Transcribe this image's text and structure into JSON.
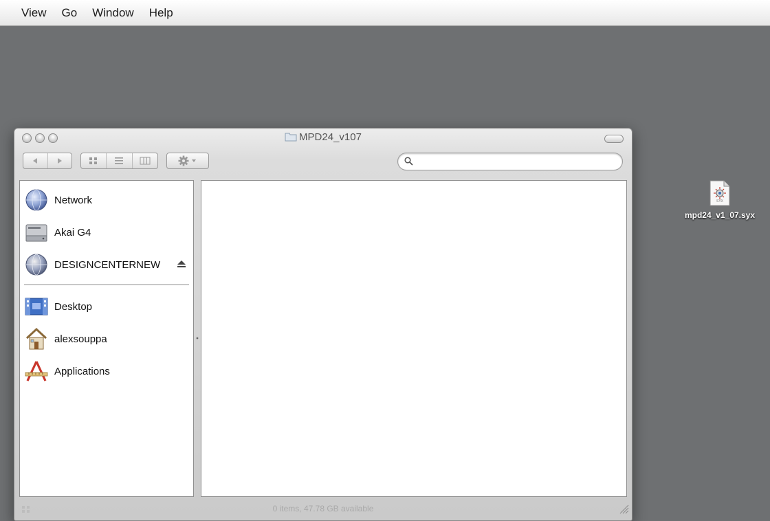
{
  "menubar": {
    "items": [
      "View",
      "Go",
      "Window",
      "Help"
    ]
  },
  "window": {
    "title": "MPD24_v107",
    "search": {
      "value": "",
      "placeholder": ""
    },
    "status": "0 items, 47.78 GB available"
  },
  "sidebar": {
    "devices": [
      {
        "label": "Network",
        "icon": "network-icon"
      },
      {
        "label": "Akai G4",
        "icon": "hard-drive-icon"
      },
      {
        "label": "DESIGNCENTERNEW",
        "icon": "network-volume-icon",
        "ejectable": true
      }
    ],
    "places": [
      {
        "label": "Desktop",
        "icon": "desktop-folder-icon"
      },
      {
        "label": "alexsouppa",
        "icon": "home-icon"
      },
      {
        "label": "Applications",
        "icon": "applications-icon"
      }
    ]
  },
  "desktop": {
    "file": {
      "name": "mpd24_v1_07.syx",
      "icon": "syx-file-icon",
      "badge": "SYX"
    }
  }
}
